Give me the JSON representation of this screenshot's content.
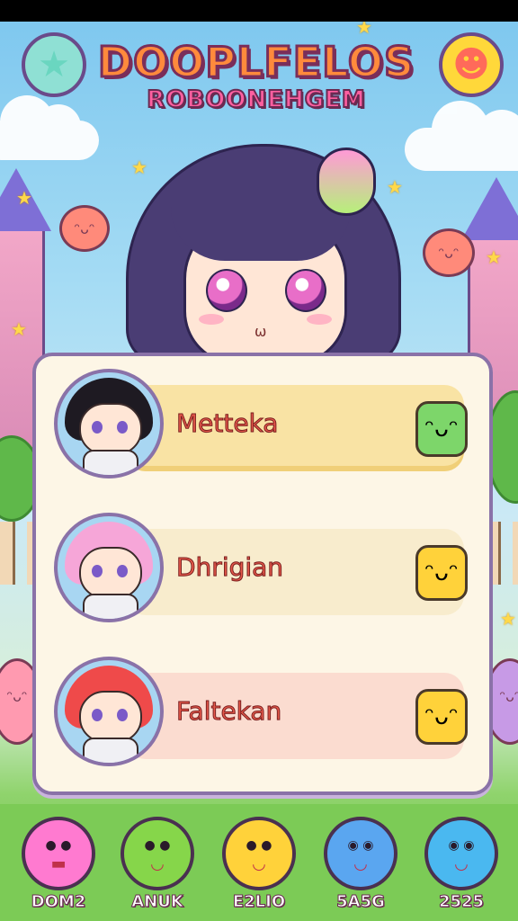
{
  "game": {
    "title_line1": "DOOPLFELOS",
    "title_line2": "ROBOONEHGEM"
  },
  "corner_buttons": {
    "left_icon": "star-icon",
    "right_icon": "smiley-icon"
  },
  "characters": [
    {
      "name": "Metteka",
      "hair_color": "#1e1a22",
      "badge_color": "#7dd66a",
      "badge_icon": "green-monster-icon"
    },
    {
      "name": "Dhrigian",
      "hair_color": "#f6a6d8",
      "badge_color": "#ffd23a",
      "badge_icon": "yellow-monster-icon"
    },
    {
      "name": "Faltekan",
      "hair_color": "#ef4a4a",
      "badge_color": "#ffd23a",
      "badge_icon": "yellow-monster-icon"
    }
  ],
  "bottom_nav": [
    {
      "label": "DOM2",
      "color": "#ff7ad0",
      "icon": "pink-monster-icon"
    },
    {
      "label": "ANUK",
      "color": "#86d64a",
      "icon": "green-monster-icon"
    },
    {
      "label": "E2LIO",
      "color": "#ffd23a",
      "icon": "yellow-monster-icon"
    },
    {
      "label": "5A5G",
      "color": "#5aa6f0",
      "icon": "blue-monster-icon"
    },
    {
      "label": "2525",
      "color": "#4ab8f0",
      "icon": "cyan-monster-icon"
    }
  ]
}
